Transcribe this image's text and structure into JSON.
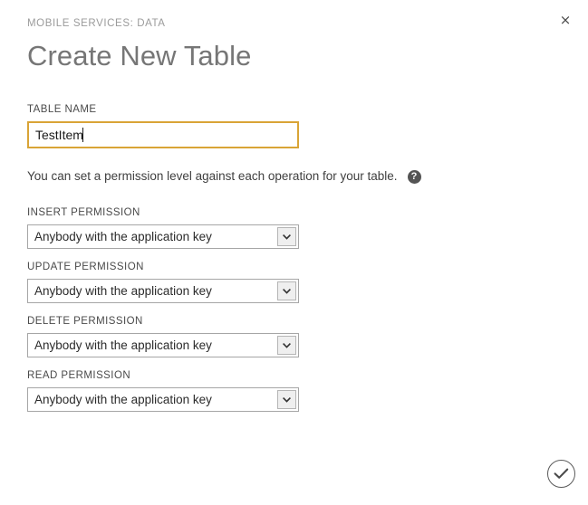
{
  "dialog": {
    "eyebrow": "MOBILE SERVICES: DATA",
    "title": "Create New Table",
    "close_label": "×",
    "close_icon": "close-icon"
  },
  "form": {
    "table_name": {
      "label": "TABLE NAME",
      "value": "TestItem",
      "placeholder": ""
    },
    "description": "You can set a permission level against each operation for your table.",
    "help_icon": "help-icon",
    "help_glyph": "?",
    "permissions": [
      {
        "label": "INSERT PERMISSION",
        "value": "Anybody with the application key",
        "name": "insert-permission"
      },
      {
        "label": "UPDATE PERMISSION",
        "value": "Anybody with the application key",
        "name": "update-permission"
      },
      {
        "label": "DELETE PERMISSION",
        "value": "Anybody with the application key",
        "name": "delete-permission"
      },
      {
        "label": "READ PERMISSION",
        "value": "Anybody with the application key",
        "name": "read-permission"
      }
    ]
  },
  "footer": {
    "confirm_icon": "check-circle-icon",
    "confirm_label": "✓"
  },
  "colors": {
    "accent": "#d9a436",
    "title": "#767676",
    "eyebrow": "#9b9b9b",
    "text": "#3f3f3f",
    "select_border": "#a6a6a6",
    "arrow_bg": "#efefef",
    "confirm_border": "#5a5a5a",
    "help_bg": "#545454",
    "background": "#ffffff"
  }
}
